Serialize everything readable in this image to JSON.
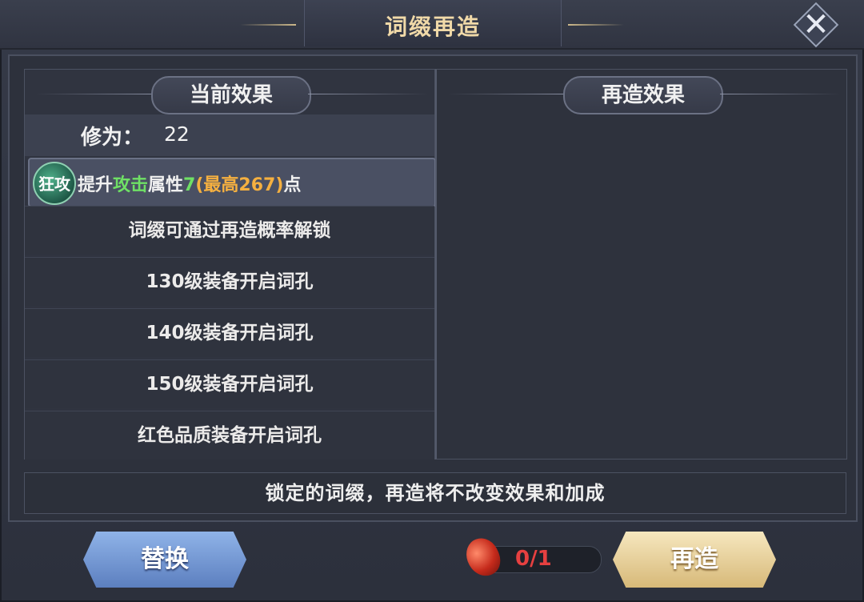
{
  "dialog": {
    "title": "词缀再造",
    "close_icon": "close-icon"
  },
  "current": {
    "header": "当前效果",
    "cultivation_label": "修为：",
    "cultivation_value": "22",
    "affix": {
      "icon_text": "狂攻",
      "prefix": "提升",
      "attr": "攻击",
      "suffix": "属性",
      "value": "7",
      "max": "(最高267)",
      "unit": "点"
    },
    "slots": [
      "词缀可通过再造概率解锁",
      "130级装备开启词孔",
      "140级装备开启词孔",
      "150级装备开启词孔",
      "红色品质装备开启词孔"
    ]
  },
  "reforged": {
    "header": "再造效果"
  },
  "notice": "锁定的词缀，再造将不改变效果和加成",
  "actions": {
    "replace_label": "替换",
    "reforge_label": "再造",
    "cost": "0/1",
    "cost_color": "#e64040"
  }
}
